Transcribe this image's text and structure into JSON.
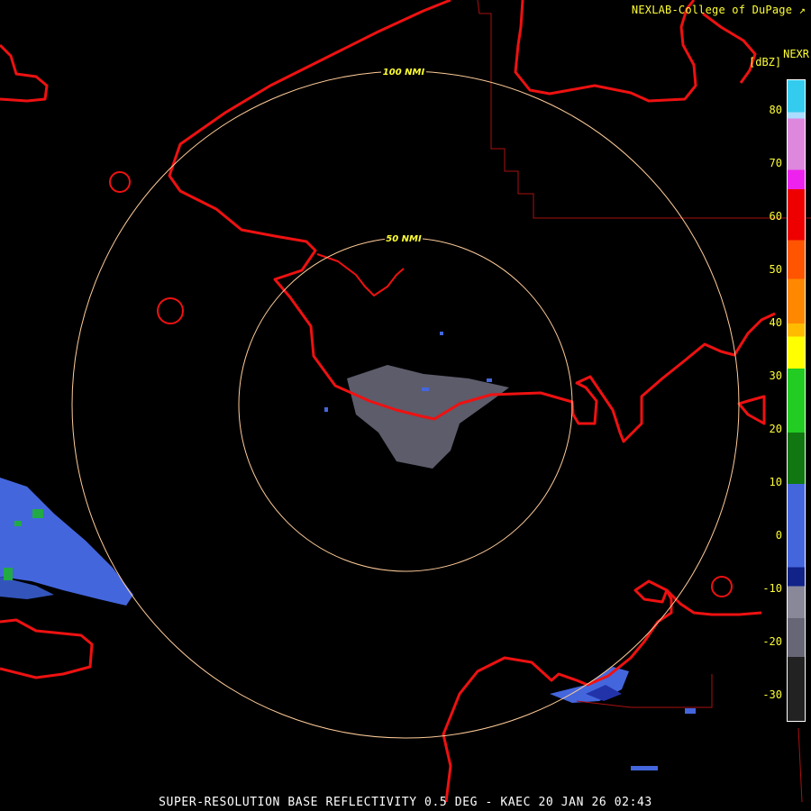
{
  "header": {
    "credit": "NEXLAB-College of DuPage",
    "credit_icon": "external-link-icon",
    "product": "NEXR",
    "units": "[dBZ]"
  },
  "range_rings": [
    {
      "label": "100 NMI"
    },
    {
      "label": "50 NMI"
    }
  ],
  "legend": {
    "ticks": [
      "80",
      "70",
      "60",
      "50",
      "40",
      "30",
      "20",
      "10",
      "0",
      "-10",
      "-20",
      "-30"
    ],
    "colors": {
      "cyan": "#33ccee",
      "magenta": "#ee22ee",
      "red": "#ee0000",
      "orange": "#ff8800",
      "yellow": "#ffff00",
      "green": "#22cc22",
      "blue": "#4466dd",
      "gray": "#666677"
    }
  },
  "footer": "SUPER-RESOLUTION BASE REFLECTIVITY 0.5 DEG - KAEC 20 JAN 26 02:43"
}
